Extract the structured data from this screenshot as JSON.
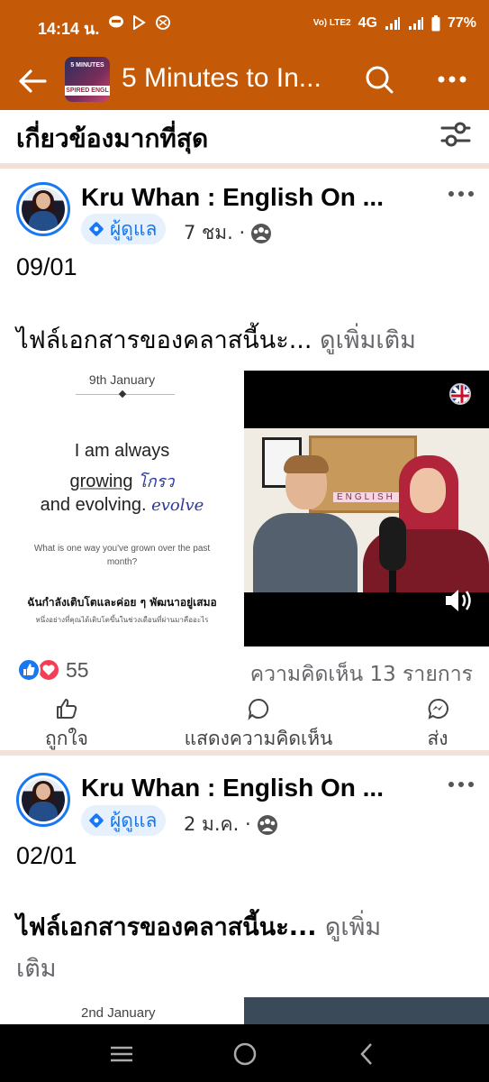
{
  "status_bar": {
    "time": "14:14 น.",
    "network": "Vo) LTE2",
    "net_type": "4G",
    "battery": "77%"
  },
  "header": {
    "title": "5 Minutes to In...",
    "thumb_line1": "5 MINUTES",
    "thumb_line2": "SPIRED ENGL"
  },
  "section": {
    "label": "เกี่ยวข้องมากที่สุด"
  },
  "posts": [
    {
      "author": "Kru Whan : English On ...",
      "badge": "ผู้ดูแล",
      "time": "7 ชม. ·",
      "date_text": "09/01",
      "body": "ไฟล์เอกสารของคลาสนี้นะ...",
      "see_more": "ดูเพิ่มเติม",
      "media": {
        "date": "9th January",
        "line1": "I am always",
        "line2_a": "growing",
        "line2_hand": "โกรว",
        "line3_a": "and evolving.",
        "line3_hand": "evolve",
        "question": "What is one way you've grown over the past month?",
        "thai1": "ฉันกำลังเติบโตและค่อย ๆ พัฒนาอยู่เสมอ",
        "thai2": "หนึ่งอย่างที่คุณได้เติบโตขึ้นในช่วงเดือนที่ผ่านมาคืออะไร",
        "board_text": "ENGLISH"
      },
      "reaction_count": "55",
      "comment_count": "ความคิดเห็น 13 รายการ",
      "actions": {
        "like": "ถูกใจ",
        "comment": "แสดงความคิดเห็น",
        "send": "ส่ง"
      }
    },
    {
      "author": "Kru Whan : English On ...",
      "badge": "ผู้ดูแล",
      "time": "2 ม.ค. ·",
      "date_text": "02/01",
      "body": "ไฟล์เอกสารของคลาสนี้นะ...",
      "see_more_1": "ดูเพิ่ม",
      "see_more_2": "เติม",
      "media": {
        "date": "2nd January"
      }
    }
  ],
  "colors": {
    "brand": "#c45a07",
    "facebook_blue": "#1877f2",
    "love_red": "#f33e58"
  }
}
